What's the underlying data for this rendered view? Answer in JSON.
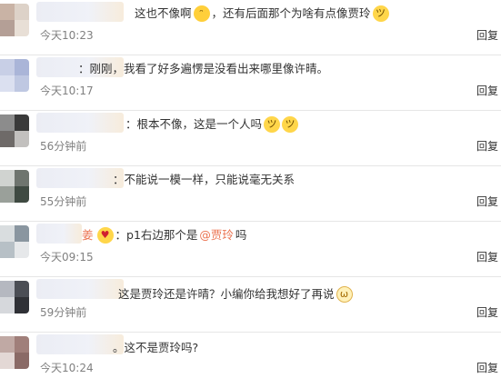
{
  "comments": [
    {
      "text": "这也不像啊",
      "extra_text": "，还有后面那个为啥有点像贾玲",
      "mention": "",
      "timestamp": "今天10:23",
      "reply_label": "回复",
      "avatar_colors": [
        "#c9b3a5",
        "#ddd2c8",
        "#b49f96",
        "#e8dfd6"
      ]
    },
    {
      "text": "：刚刚，我看了好多遍愣是没看出来哪里像许晴。",
      "timestamp": "今天10:17",
      "reply_label": "回复",
      "avatar_colors": [
        "#c8cfe6",
        "#aab5d8",
        "#dbe0f0",
        "#bfc8e2"
      ]
    },
    {
      "text": "：根本不像，这是一个人吗",
      "timestamp": "56分钟前",
      "reply_label": "回复",
      "avatar_colors": [
        "#8c8c8c",
        "#3a3a3a",
        "#6e6a68",
        "#c2c0be"
      ]
    },
    {
      "text": "：不能说一模一样，只能说毫无关系",
      "timestamp": "55分钟前",
      "reply_label": "回复",
      "avatar_colors": [
        "#d0d3d0",
        "#6f756f",
        "#9aa09a",
        "#3f4a42"
      ]
    },
    {
      "name_tail": "姜",
      "text": "：p1右边那个是",
      "mention": "@贾玲",
      "extra_text": " 吗",
      "timestamp": "今天09:15",
      "reply_label": "回复",
      "avatar_colors": [
        "#d9dddf",
        "#8a96a0",
        "#b7c0c6",
        "#e6e8ea"
      ]
    },
    {
      "text": "这是贾玲还是许晴？小编你给我想好了再说",
      "timestamp": "59分钟前",
      "reply_label": "回复",
      "avatar_colors": [
        "#b5b8c0",
        "#4b4e55",
        "#d6d8dc",
        "#2f3136"
      ]
    },
    {
      "text": "。这不是贾玲吗?",
      "timestamp": "今天10:24",
      "reply_label": "回复",
      "avatar_colors": [
        "#c0a9a4",
        "#a07f7a",
        "#e3d8d5",
        "#8a6a66"
      ]
    }
  ],
  "emoji_icons": {
    "shrug": "shrug-emoji-icon",
    "sweat": "sweat-emoji-icon",
    "cat": "cat-emoji-icon",
    "heart_eyes": "heart-eyes-emoji-icon"
  },
  "colors": {
    "mention": "#eb7350",
    "timestamp": "#808080",
    "divider": "#e6e6e6"
  }
}
